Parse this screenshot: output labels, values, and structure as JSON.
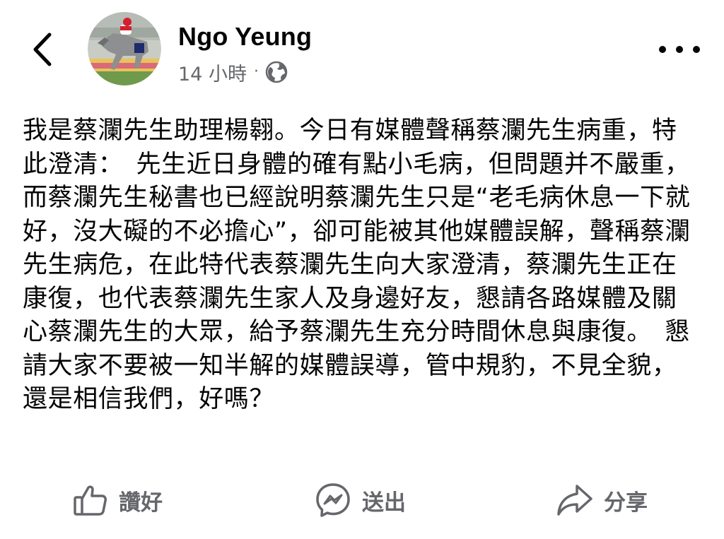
{
  "header": {
    "back_icon": "chevron-left-icon",
    "author_name": "Ngo Yeung",
    "timestamp": "14 小時",
    "separator": "·",
    "audience_icon": "globe-icon",
    "more_icon": "more-horizontal-icon"
  },
  "post": {
    "text": "我是蔡瀾先生助理楊翱。今日有媒體聲稱蔡瀾先生病重，特此澄清：　先生近日身體的確有點小毛病，但問題并不嚴重，而蔡瀾先生秘書也已經說明蔡瀾先生只是“老毛病休息一下就好，沒大礙的不必擔心”，卻可能被其他媒體誤解，聲稱蔡瀾先生病危，在此特代表蔡瀾先生向大家澄清，蔡瀾先生正在康復，也代表蔡瀾先生家人及身邊好友，懇請各路媒體及關心蔡瀾先生的大眾，給予蔡瀾先生充分時間休息與康復。　懇請大家不要被一知半解的媒體誤導，管中規豹，不見全貌，還是相信我們，好嗎？"
  },
  "actions": [
    {
      "label": "讚好",
      "icon": "thumbs-up-icon"
    },
    {
      "label": "送出",
      "icon": "messenger-icon"
    },
    {
      "label": "分享",
      "icon": "share-arrow-icon"
    }
  ],
  "colors": {
    "text_primary": "#050505",
    "text_secondary": "#65676b",
    "background": "#ffffff"
  }
}
